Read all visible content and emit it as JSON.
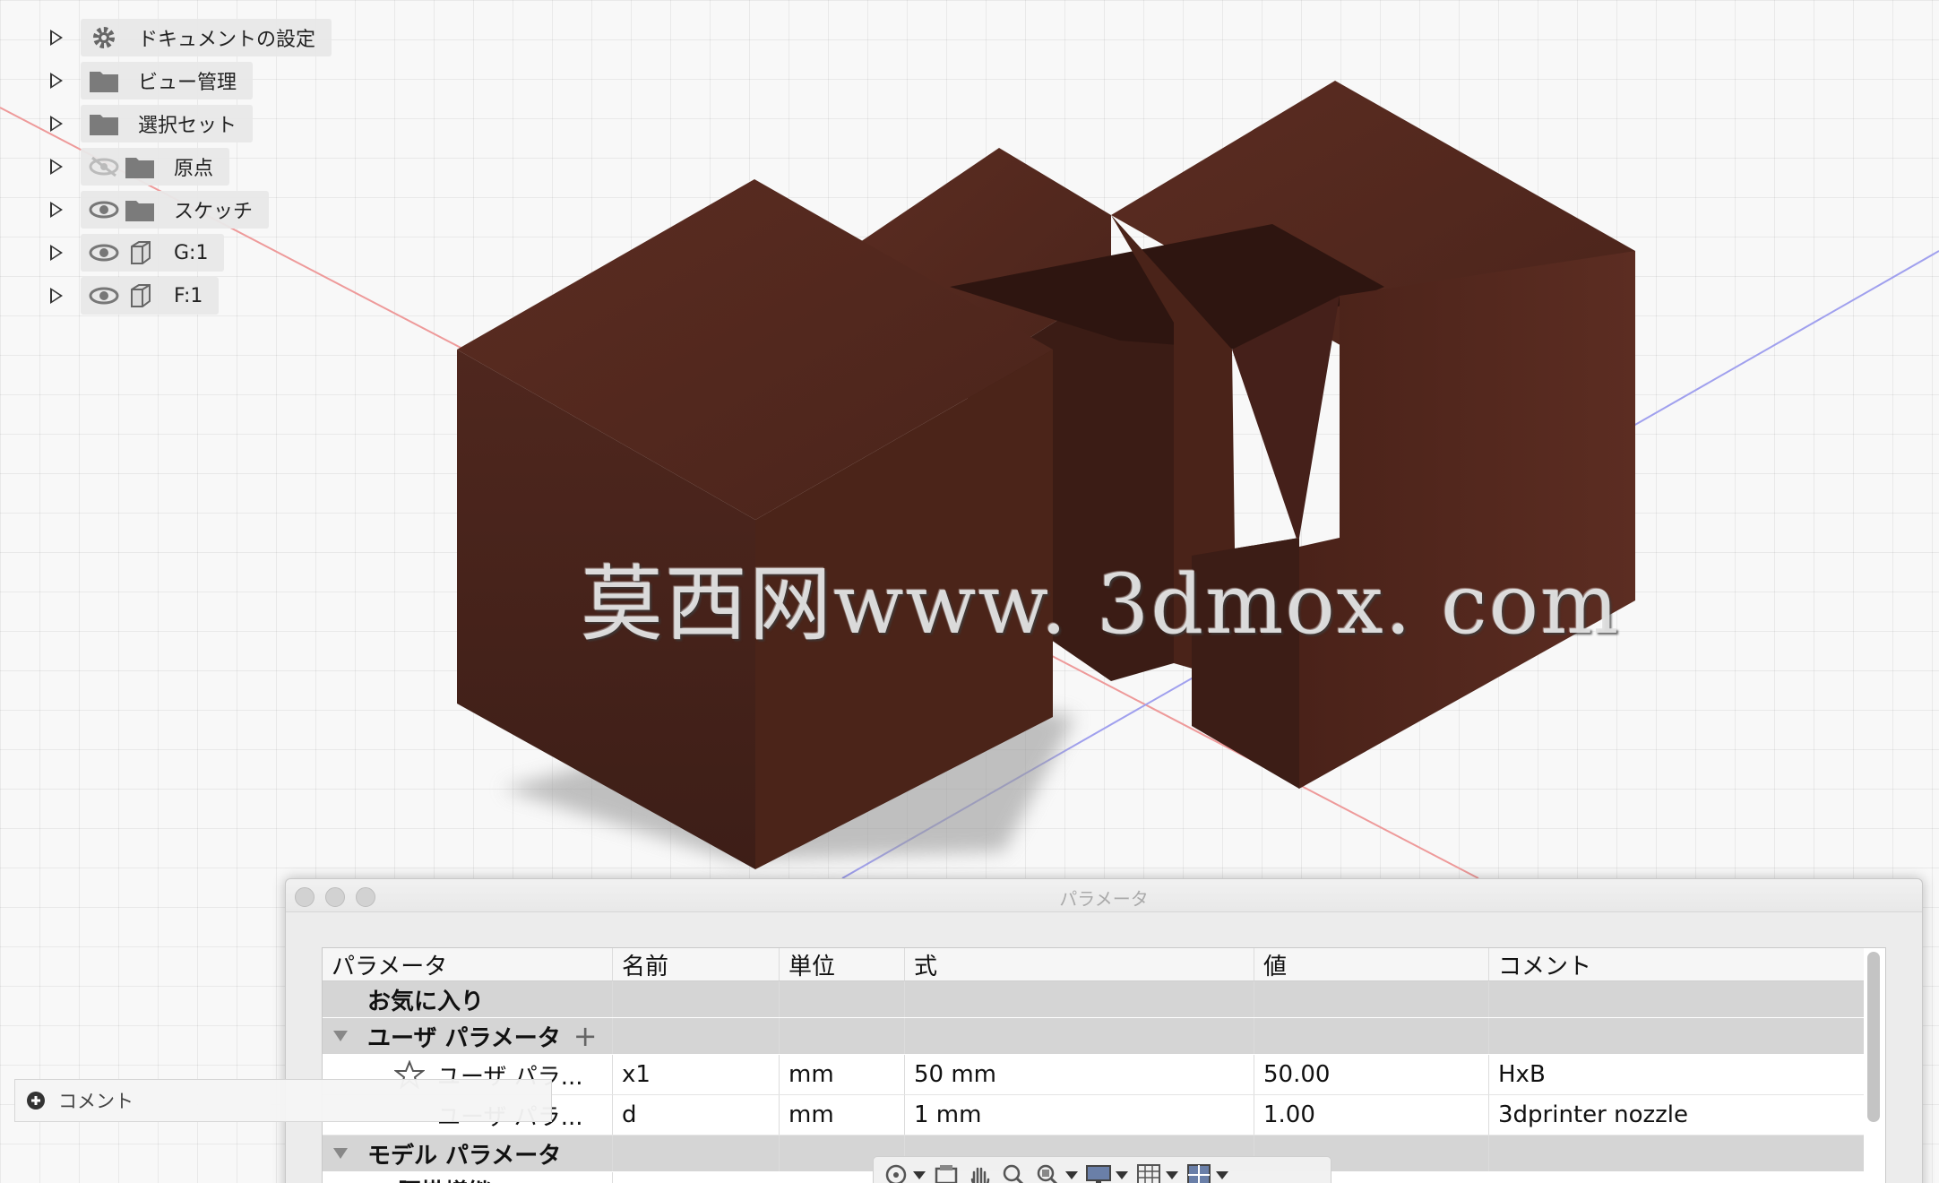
{
  "browser": {
    "items": [
      {
        "label": "ドキュメントの設定",
        "icon": "gear-icon"
      },
      {
        "label": "ビュー管理",
        "icon": "folder-icon"
      },
      {
        "label": "選択セット",
        "icon": "folder-icon"
      },
      {
        "label": "原点",
        "icon": "folder-icon",
        "visibility": "hidden-eye-icon"
      },
      {
        "label": "スケッチ",
        "icon": "folder-icon",
        "visibility": "eye-icon"
      },
      {
        "label": "G:1",
        "icon": "body-icon",
        "visibility": "eye-icon"
      },
      {
        "label": "F:1",
        "icon": "body-icon",
        "visibility": "eye-icon"
      }
    ]
  },
  "watermark": "莫西网www. 3dmox. com",
  "dialog": {
    "title": "パラメータ",
    "columns": [
      "パラメータ",
      "名前",
      "単位",
      "式",
      "値",
      "コメント"
    ],
    "group_favorites": "お気に入り",
    "group_user": "ユーザ パラメータ",
    "add_symbol": "+",
    "user_rows": [
      {
        "param": "ユーザ パラ...",
        "name": "x1",
        "unit": "mm",
        "expr": "50 mm",
        "value": "50.00",
        "comment": "HxB"
      },
      {
        "param": "ユーザ パラ...",
        "name": "d",
        "unit": "mm",
        "expr": "1 mm",
        "value": "1.00",
        "comment": "3dprinter nozzle"
      }
    ],
    "group_model": "モデル パラメータ",
    "sub_group": "腰掛蟻継 _Dovet"
  },
  "comment_bar": {
    "label": "コメント"
  },
  "colors": {
    "wood_dark": "#3e1f17",
    "wood_mid": "#54291f",
    "wood_light": "#6a3526",
    "axis_red": "#e88a8a",
    "axis_blue": "#8a8ae8"
  }
}
